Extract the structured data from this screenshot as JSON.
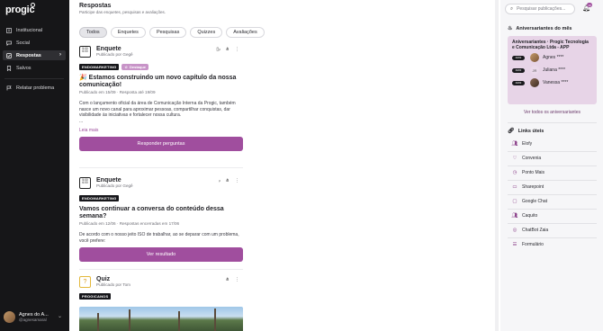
{
  "app": {
    "logo": "progic"
  },
  "sidebar": {
    "items": [
      {
        "label": "Institucional",
        "icon": "building-icon"
      },
      {
        "label": "Social",
        "icon": "chat-icon"
      },
      {
        "label": "Respostas",
        "icon": "reply-icon",
        "active": true
      },
      {
        "label": "Salvos",
        "icon": "bookmark-icon"
      },
      {
        "label": "Relatar problema",
        "icon": "flag-icon"
      }
    ],
    "user": {
      "name": "Agnes do A...",
      "handle": "@agnesamaral"
    }
  },
  "main": {
    "title": "Respostas",
    "subtitle": "Participe das enquetes, pesquisas e avaliações.",
    "tabs": [
      "Todos",
      "Enquetes",
      "Pesquisas",
      "Quizzes",
      "Avaliações"
    ],
    "posts": [
      {
        "type": "Enquete",
        "by": "Publicado por Gegê",
        "icon_text": "5:00 6:00",
        "chip1": "ENDOMARKETING",
        "chip2": "Destaque",
        "title": "🎉 Estamos construindo um novo capítulo da nossa comunicação!",
        "meta": "Publicado em 15/09 · Resposta até 19/09",
        "body": "Com o lançamento oficial da área de Comunicação Interna da Progic, também nasce um novo canal para aproximar pessoas, compartilhar conquistas, dar visibilidade às iniciativas e fortalecer nossa cultura.",
        "ellipsis": "...",
        "read_more": "Leia mais",
        "cta": "Responder perguntas"
      },
      {
        "type": "Enquete",
        "by": "Publicado por Gegê",
        "icon_text": "5:00 6:00",
        "chip1": "ENDOMARKETING",
        "title": "Vamos continuar a conversa do conteúdo dessa semana?",
        "meta": "Publicado em 12/06 · Respostas encerradas em 17/06",
        "body": "De acordo com o nosso jeito ISO de trabalhar, ao se deparar com um problema, você prefere:",
        "cta": "Ver resultado"
      },
      {
        "type": "Quiz",
        "by": "Publicado por Tom",
        "icon_text": "?",
        "chip1": "PROGICANOS"
      }
    ]
  },
  "right": {
    "search_placeholder": "Pesquisar publicações...",
    "notif_count": "10",
    "birthdays_title": "Aniversariantes do mês",
    "birthday_card_title": "Aniversariantes · Progic Tecnologia e Comunicação Ltda - APP",
    "birthdays": [
      {
        "date": "00/00",
        "name": "Agnes ****"
      },
      {
        "date": "00/00",
        "name": "Juliana ****",
        "initials": "JR"
      },
      {
        "date": "00/00",
        "name": "Vanessa ****"
      }
    ],
    "see_all": "Ver todos os aniversariantes",
    "links_title": "Links úteis",
    "links": [
      "Elofy",
      "Convenia",
      "Ponto Mais",
      "Sharepoint",
      "Google Chat",
      "Caquito",
      "ChatBot Zaia",
      "Formulário"
    ]
  },
  "colors": {
    "accent": "#a04e9e",
    "sidebar_bg": "#161618",
    "birthday_bg": "#e7d4e7"
  }
}
